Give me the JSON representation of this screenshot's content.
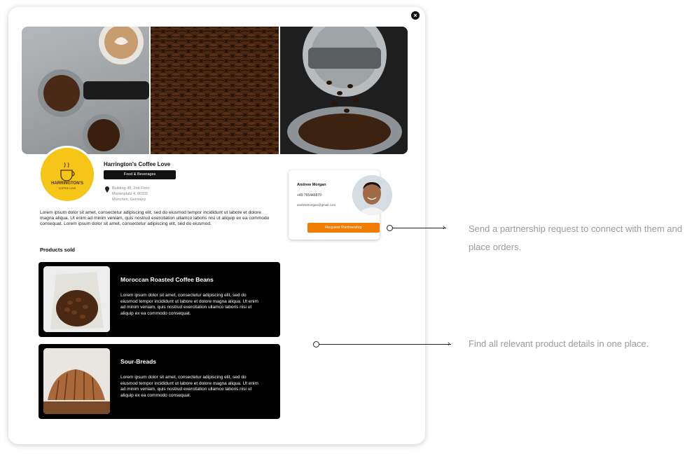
{
  "close_label": "×",
  "business": {
    "name": "Harrington's Coffee Love",
    "category": "Food & Beverages",
    "address_lines": [
      "Building 48, 2nd Floor",
      "Marienplatz 4, 80331",
      "München, Germany"
    ],
    "logo_text": "HARRINGTON'S",
    "logo_sub": "COFFEE LOVE",
    "description": "Lorem ipsum dolor sit amet, consectetur adipiscing elit, sed do eiusmod tempor incididunt ut labore et dolore magna aliqua. Ut enim ad minim veniam, quis nostrud exercitation ullamco laboris nisi ut aliquip ex ea commodo consequat. Lorem ipsum dolor sit amet, consectetur adipiscing elit, sed do eiusmod."
  },
  "contact": {
    "name": "Andrew Morgan",
    "phone": "+49 765446879",
    "email": "andrewmorgan@gmail.com",
    "request_button": "Request Partnership"
  },
  "products": {
    "title": "Products sold",
    "items": [
      {
        "name": "Moroccan Roasted Coffee Beans",
        "description": "Lorem ipsum dolor sit amet, consectetur adipiscing elit, sed do eiusmod tempor incididunt ut labore et dolore magna aliqua. Ut enim ad minim veniam, quis nostrud exercitation ullamco laboris nisi ut aliquip ex ea commodo consequat."
      },
      {
        "name": "Sour-Breads",
        "description": "Lorem ipsum dolor sit amet, consectetur adipiscing elit, sed do eiusmod tempor incididunt ut labore et dolore magna aliqua. Ut enim ad minim veniam, quis nostrud exercitation ullamco laboris nisi ut aliquip ex ea commodo consequat."
      }
    ]
  },
  "annotations": [
    {
      "text": "Send a partnership request to connect with them and place orders."
    },
    {
      "text": "Find all relevant product details in one place."
    }
  ],
  "colors": {
    "accent": "#f07d00",
    "logo_bg": "#f5c518",
    "product_bg": "#000000"
  }
}
